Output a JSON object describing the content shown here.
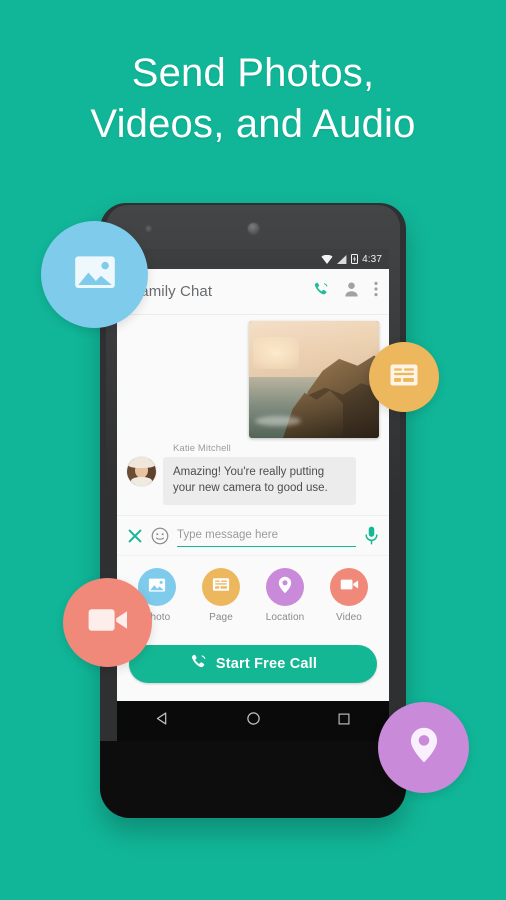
{
  "theme": {
    "background": "#11b698",
    "accent": "#14b793",
    "headline_color": "#ffffff"
  },
  "headline": {
    "line1": "Send Photos,",
    "line2": "Videos, and Audio"
  },
  "phone": {
    "statusbar": {
      "clock": "4:37",
      "icons": [
        "wifi-icon",
        "signal-icon",
        "battery-charging-icon"
      ]
    },
    "appbar": {
      "title": "Family Chat",
      "actions": [
        {
          "name": "call-icon",
          "label": "Call",
          "color": "#16b793"
        },
        {
          "name": "contact-icon",
          "label": "Contact",
          "color": "#9b9b9b"
        },
        {
          "name": "overflow-menu-icon",
          "label": "More options",
          "color": "#9b9b9b"
        }
      ]
    },
    "conversation": {
      "photo_message": {
        "name": "photo-attachment",
        "description": "Coastal cliffs at sunset"
      },
      "message": {
        "sender": "Katie Mitchell",
        "text": "Amazing! You're really putting your new camera to good use."
      }
    },
    "composer": {
      "close_label": "Close",
      "emoji_label": "Emoji",
      "placeholder": "Type message here",
      "value": "",
      "mic_label": "Voice message",
      "underline_color": "#13b898"
    },
    "attachments": [
      {
        "label": "Photo",
        "icon": "image-icon",
        "color": "#7fcbec"
      },
      {
        "label": "Page",
        "icon": "page-icon",
        "color": "#edb75e"
      },
      {
        "label": "Location",
        "icon": "location-icon",
        "color": "#c88ad9"
      },
      {
        "label": "Video",
        "icon": "video-icon",
        "color": "#f0897a"
      }
    ],
    "cta": {
      "label": "Start Free Call",
      "icon": "phone-icon",
      "color": "#14b793"
    },
    "navbar": [
      {
        "name": "nav-back-icon",
        "label": "Back"
      },
      {
        "name": "nav-home-icon",
        "label": "Home"
      },
      {
        "name": "nav-recents-icon",
        "label": "Recents"
      }
    ]
  },
  "floating_circles": [
    {
      "name": "floating-photo-circle",
      "icon": "image-icon",
      "color": "#7fcbec"
    },
    {
      "name": "floating-page-circle",
      "icon": "page-icon",
      "color": "#edb75e"
    },
    {
      "name": "floating-video-circle",
      "icon": "video-icon",
      "color": "#f0897a"
    },
    {
      "name": "floating-location-circle",
      "icon": "location-icon",
      "color": "#c88ad9"
    }
  ]
}
